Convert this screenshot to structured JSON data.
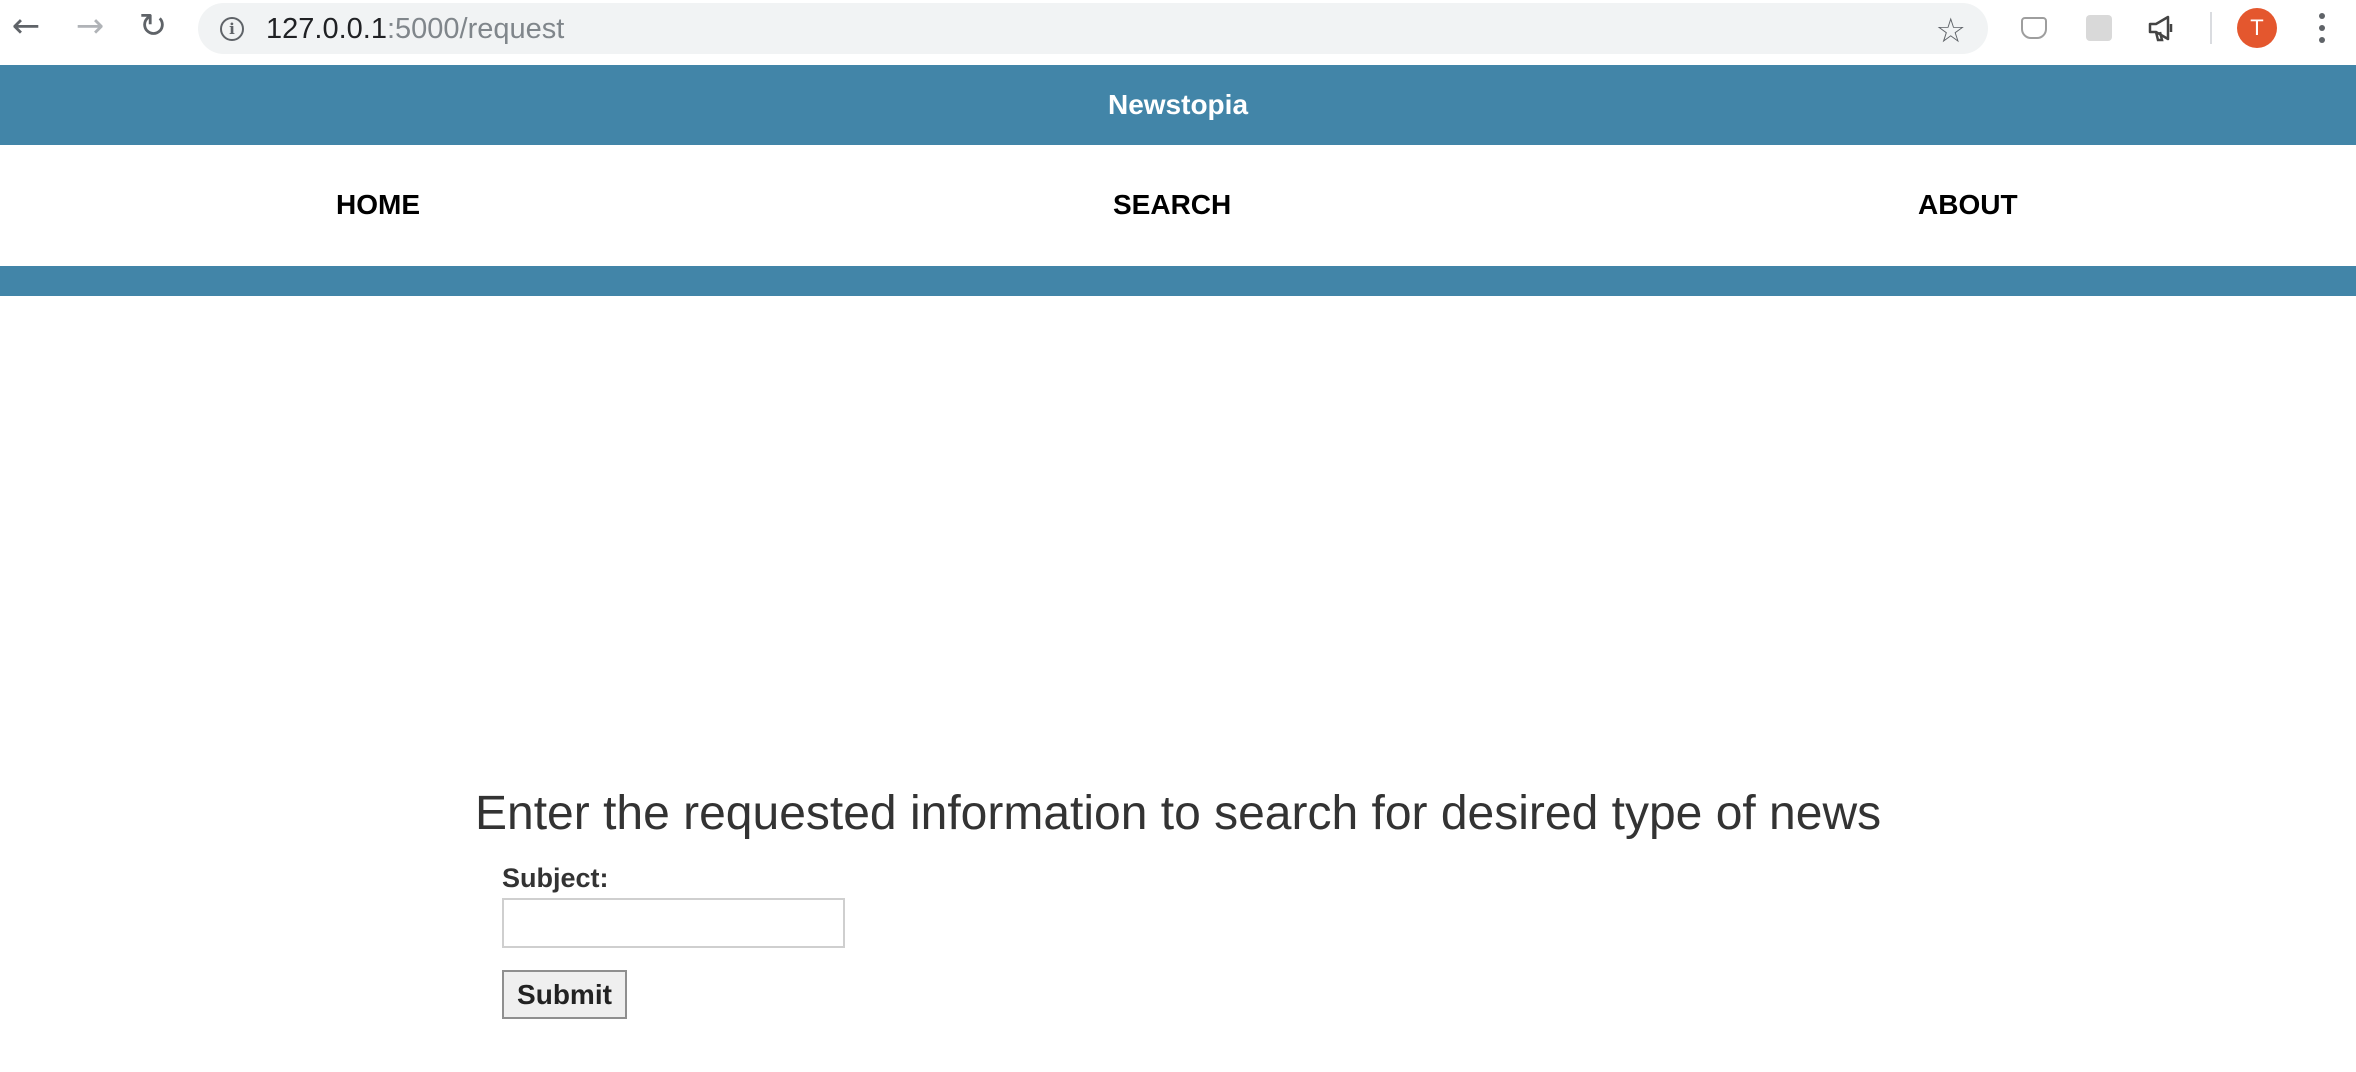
{
  "browser": {
    "back_icon": "←",
    "forward_icon": "→",
    "reload_icon": "↻",
    "info_icon": "i",
    "url_host": "127.0.0.1",
    "url_rest": ":5000/request",
    "star_icon": "☆",
    "profile_initial": "T",
    "profile_color": "#e4572e"
  },
  "site": {
    "title": "Newstopia",
    "brand_color": "#4285a8"
  },
  "nav": {
    "home": "HOME",
    "search": "SEARCH",
    "about": "ABOUT"
  },
  "form": {
    "heading": "Enter the requested information to search for desired type of news",
    "subject_label": "Subject:",
    "subject_value": "",
    "submit_label": "Submit"
  }
}
